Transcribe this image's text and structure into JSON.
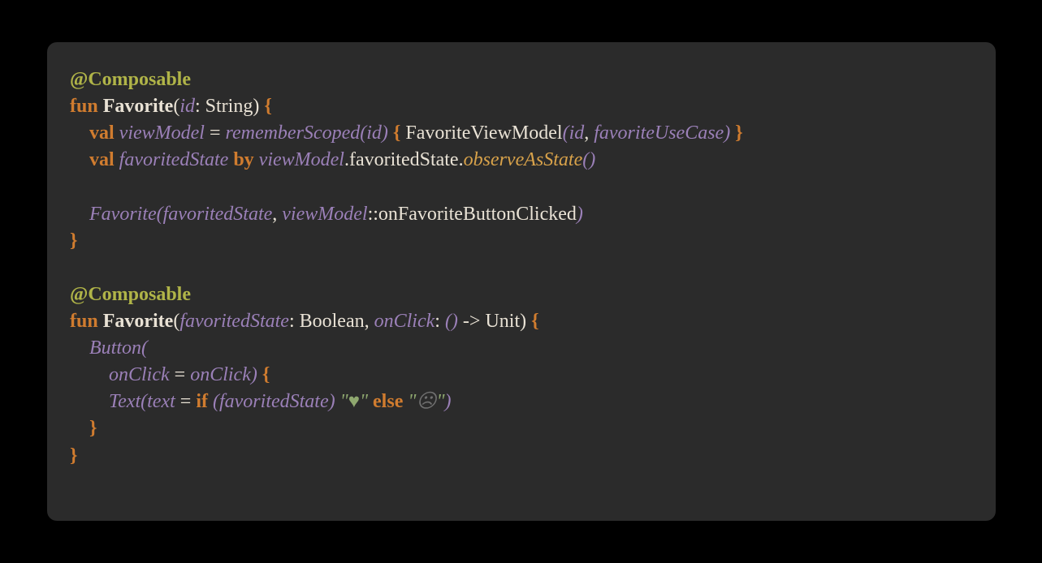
{
  "colors": {
    "page_bg": "#000000",
    "panel_bg": "#2b2b2b",
    "annotation": "#b0b448",
    "keyword": "#d07c2f",
    "identifier_light": "#e9e2d5",
    "identifier_purple": "#9b80b8",
    "member_amber": "#d8a24a",
    "string_green": "#8fa86f",
    "string_muted": "#707070"
  },
  "code": {
    "l1": {
      "annotation": "@Composable"
    },
    "l2": {
      "kw_fun": "fun",
      "fname": "Favorite",
      "paren_open": "(",
      "p_id": "id",
      "colon_sp": ": ",
      "t_string": "String",
      "paren_close_sp": ") ",
      "brace_open": "{"
    },
    "l3": {
      "indent": "    ",
      "kw_val": "val",
      "sp1": " ",
      "v_viewModel": "viewModel",
      "sp_eq_sp": " = ",
      "f_rememberScoped": "rememberScoped",
      "paren_open": "(",
      "a_id": "id",
      "paren_close_sp": ") ",
      "brace_open": "{",
      "sp2": " ",
      "cl_FavoriteViewModel": "FavoriteViewModel",
      "paren_open2": "(",
      "a_id2": "id",
      "comma_sp": ", ",
      "a_favoriteUseCase": "favoriteUseCase",
      "paren_close2": ")",
      "sp3": " ",
      "brace_close": "}"
    },
    "l4": {
      "indent": "    ",
      "kw_val": "val",
      "sp1": " ",
      "v_favoritedState": "favoritedState",
      "sp2": " ",
      "kw_by": "by",
      "sp3": " ",
      "r_viewModel": "viewModel",
      "dot1": ".",
      "m_favoritedState": "favoritedState",
      "dot2": ".",
      "m_observeAsState": "observeAsState",
      "parens": "()"
    },
    "l6": {
      "indent": "    ",
      "f_Favorite": "Favorite",
      "paren_open": "(",
      "a_favoritedState": "favoritedState",
      "comma_sp": ", ",
      "r_viewModel": "viewModel",
      "dcolon": "::",
      "m_onFavoriteButtonClicked": "onFavoriteButtonClicked",
      "paren_close": ")"
    },
    "l7": {
      "brace_close": "}"
    },
    "l9": {
      "annotation": "@Composable"
    },
    "l10": {
      "kw_fun": "fun",
      "fname": "Favorite",
      "paren_open": "(",
      "p_favoritedState": "favoritedState",
      "colon_sp1": ": ",
      "t_boolean": "Boolean",
      "comma_sp": ", ",
      "p_onClick": "onClick",
      "colon_sp2": ": ",
      "t_fn_lp": "()",
      "sp_arrow_sp": " -> ",
      "t_unit": "Unit",
      "paren_close_sp": ") ",
      "brace_open": "{"
    },
    "l11": {
      "indent": "    ",
      "f_Button": "Button",
      "paren_open": "("
    },
    "l12": {
      "indent": "        ",
      "p_onClick": "onClick",
      "sp_eq_sp": " = ",
      "r_onClick": "onClick",
      "paren_close_sp": ") ",
      "brace_open": "{"
    },
    "l13": {
      "indent": "        ",
      "f_Text": "Text",
      "paren_open": "(",
      "p_text": "text",
      "sp_eq_sp": " = ",
      "kw_if": "if",
      "sp1": " ",
      "paren_open2": "(",
      "r_favoritedState": "favoritedState",
      "paren_close2": ")",
      "sp2": " ",
      "q1": "\"",
      "s_heart": "♥",
      "q2": "\"",
      "sp3": " ",
      "kw_else": "else",
      "sp4": " ",
      "q3": "\"",
      "s_sad": "☹",
      "q4": "\"",
      "paren_close": ")"
    },
    "l14": {
      "indent": "    ",
      "brace_close": "}"
    },
    "l15": {
      "brace_close": "}"
    }
  }
}
